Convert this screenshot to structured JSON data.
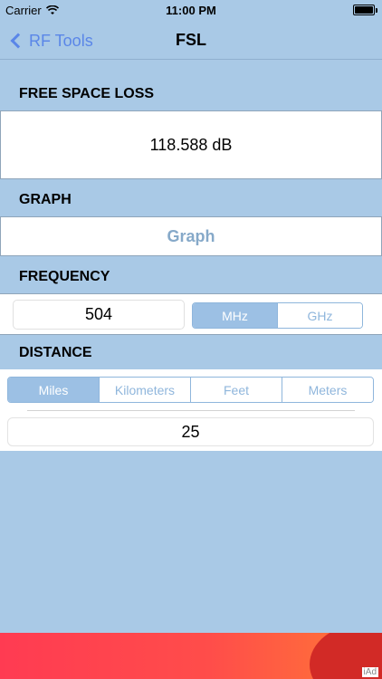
{
  "status_bar": {
    "carrier": "Carrier",
    "time": "11:00 PM"
  },
  "nav": {
    "back_label": "RF Tools",
    "title": "FSL"
  },
  "sections": {
    "free_space_loss": "FREE SPACE LOSS",
    "graph": "GRAPH",
    "frequency": "FREQUENCY",
    "distance": "DISTANCE"
  },
  "result": {
    "value": "118.588 dB"
  },
  "graph_button": "Graph",
  "frequency": {
    "value": "504",
    "units": [
      "MHz",
      "GHz"
    ],
    "selected": "MHz"
  },
  "distance": {
    "value": "25",
    "units": [
      "Miles",
      "Kilometers",
      "Feet",
      "Meters"
    ],
    "selected": "Miles"
  },
  "ad": {
    "label": "iAd"
  }
}
